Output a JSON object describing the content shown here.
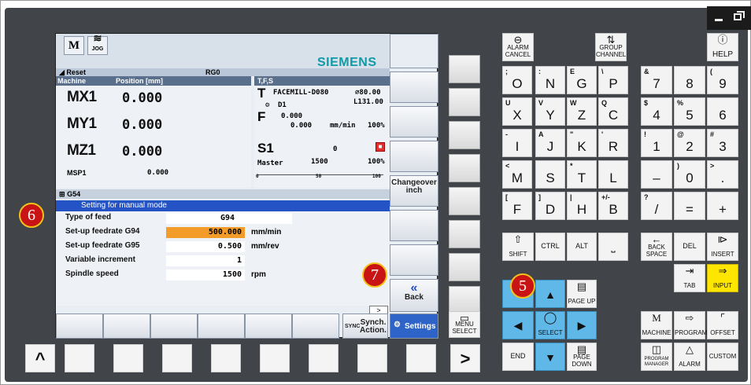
{
  "header": {
    "mode_icon": "M",
    "jog_label": "JOG",
    "brand": "SIEMENS"
  },
  "status": {
    "reset": "Reset",
    "rg": "RG0"
  },
  "position": {
    "col_machine": "Machine",
    "col_position": "Position [mm]",
    "axes": [
      {
        "name": "MX1",
        "value": "0.000"
      },
      {
        "name": "MY1",
        "value": "0.000"
      },
      {
        "name": "MZ1",
        "value": "0.000"
      }
    ],
    "spindle_name": "MSP1",
    "spindle_value": "0.000"
  },
  "tfs": {
    "title": "T,F,S",
    "t_letter": "T",
    "tool": "FACEMILL-D080",
    "diameter": "⌀80.00",
    "length": "L131.00",
    "d": "D1",
    "f_letter": "F",
    "f1": "0.000",
    "f2": "0.000",
    "f_unit": "mm/min",
    "f_pct": "100%",
    "s_letter": "S1",
    "s_val": "0",
    "master": "Master",
    "s_set": "1500",
    "s_pct": "100%",
    "scale_0": "0",
    "scale_50": "50",
    "scale_100": "100"
  },
  "wcs": "G54",
  "dialog": {
    "title": "Setting for manual mode",
    "rows": [
      {
        "label": "Type of feed",
        "value": "G94",
        "unit": ""
      },
      {
        "label": "Set-up feedrate G94",
        "value": "500.000",
        "unit": "mm/min"
      },
      {
        "label": "Set-up feedrate G95",
        "value": "0.500",
        "unit": "mm/rev"
      },
      {
        "label": "Variable increment",
        "value": "1",
        "unit": ""
      },
      {
        "label": "Spindle speed",
        "value": "1500",
        "unit": "rpm"
      }
    ],
    "more": ">"
  },
  "softkeys": {
    "changeover": "Changeover inch",
    "back_symbol": "«",
    "back": "Back",
    "sync": "Synch. Action.",
    "sync_tag": "SYNC",
    "settings": "Settings"
  },
  "side": {
    "menu_select": "MENU SELECT",
    "right_arrow": ">",
    "left_up": "^"
  },
  "keys": {
    "alarm_cancel": "ALARM CANCEL",
    "group_channel": "GROUP CHANNEL",
    "help": "HELP",
    "letters": [
      [
        "O",
        ";"
      ],
      [
        "N",
        ":"
      ],
      [
        "G",
        "E"
      ],
      [
        "P",
        "\\"
      ],
      [
        "X",
        "U"
      ],
      [
        "Y",
        "V"
      ],
      [
        "Z",
        "W"
      ],
      [
        "C",
        "Q"
      ],
      [
        "I",
        "-"
      ],
      [
        "J",
        "A"
      ],
      [
        "K",
        "\""
      ],
      [
        "R",
        "'"
      ],
      [
        "M",
        "<"
      ],
      [
        "S",
        ""
      ],
      [
        "T",
        "*"
      ],
      [
        "L",
        ""
      ],
      [
        "F",
        "["
      ],
      [
        "D",
        "]"
      ],
      [
        "H",
        "|"
      ],
      [
        "B",
        "+/-"
      ]
    ],
    "numbers": [
      [
        "7",
        "&"
      ],
      [
        "8",
        ""
      ],
      [
        "9",
        "("
      ],
      [
        "4",
        "$"
      ],
      [
        "5",
        "%"
      ],
      [
        "6",
        ""
      ],
      [
        "1",
        "!"
      ],
      [
        "2",
        "@"
      ],
      [
        "3",
        "#"
      ],
      [
        "–",
        ""
      ],
      [
        "0",
        ")"
      ],
      [
        ".",
        ">"
      ],
      [
        "/",
        "?"
      ],
      [
        "=",
        ""
      ],
      [
        "+",
        ""
      ]
    ],
    "shift": "SHIFT",
    "ctrl": "CTRL",
    "alt": "ALT",
    "backspace": "BACK SPACE",
    "del": "DEL",
    "insert": "INSERT",
    "tab": "TAB",
    "input": "INPUT",
    "page_up": "PAGE UP",
    "page_down": "PAGE DOWN",
    "select": "SELECT",
    "end": "END",
    "machine": "MACHINE",
    "program": "PROGRAM",
    "offset": "OFFSET",
    "program_manager": "PROGRAM MANAGER",
    "alarm": "ALARM",
    "custom": "CUSTOM"
  },
  "badges": {
    "b5": "5",
    "b6": "6",
    "b7": "7"
  }
}
